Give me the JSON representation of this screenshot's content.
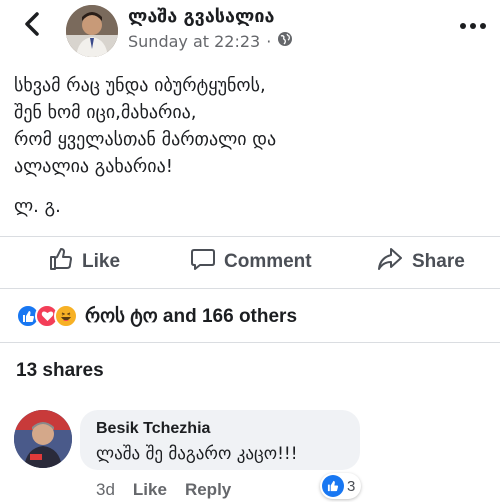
{
  "colors": {
    "text": "#1c1e21",
    "secondary": "#65676b",
    "action": "#4b4f56",
    "like_blue": "#1877f2",
    "love_red": "#f33e58",
    "haha_yellow": "#f7b125",
    "bubble": "#f0f2f5",
    "divider": "#dadde1"
  },
  "header": {
    "back_icon": "chevron-left-icon",
    "author_name": "ლაშა გვასალია",
    "timestamp": "Sunday at 22:23",
    "separator": "·",
    "audience_icon": "globe-icon",
    "more_icon": "more-dots-icon"
  },
  "post": {
    "lines": [
      "სხვამ რაც უნდა იბურტყუნოს,",
      "შენ ხომ იცი,მახარია,",
      "რომ  ყველასთან მართალი და",
      "ალალია გახარია!"
    ],
    "signature": "ლ. გ."
  },
  "actions": {
    "like_label": "Like",
    "comment_label": "Comment",
    "share_label": "Share"
  },
  "reactions": {
    "icons": [
      "like-icon",
      "love-icon",
      "haha-icon"
    ],
    "text": "როს ტო and 166 others"
  },
  "shares": {
    "text": "13 shares"
  },
  "comment": {
    "author": "Besik Tchezhia",
    "text": "ლაშა შე მაგარო კაცო!!!",
    "time": "3d",
    "like_label": "Like",
    "reply_label": "Reply",
    "reaction_icon": "like-icon",
    "reaction_count": "3"
  }
}
